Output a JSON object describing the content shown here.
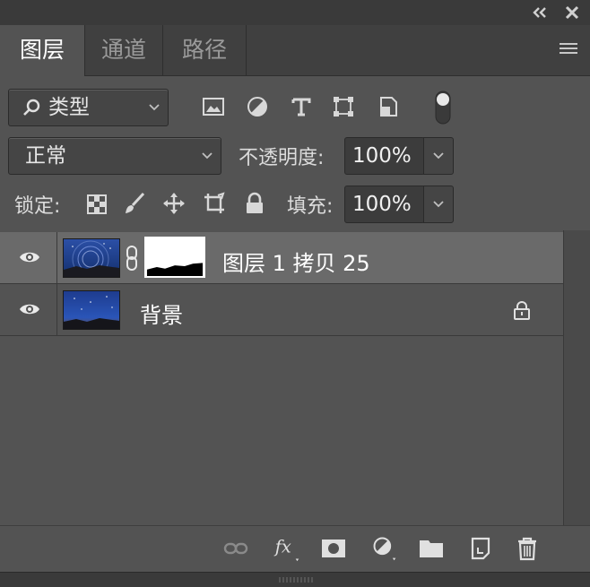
{
  "titlebar": {
    "collapse_icon": "double-chevron-left-icon",
    "close_icon": "close-icon"
  },
  "tabs": [
    {
      "label": "图层",
      "active": true
    },
    {
      "label": "通道",
      "active": false
    },
    {
      "label": "路径",
      "active": false
    }
  ],
  "filter": {
    "type_label": "类型"
  },
  "blend": {
    "mode": "正常",
    "opacity_label": "不透明度:",
    "opacity_value": "100%"
  },
  "lock": {
    "label": "锁定:",
    "fill_label": "填充:",
    "fill_value": "100%"
  },
  "layers": [
    {
      "name": "图层 1 拷贝 25",
      "visible": true,
      "selected": true,
      "has_mask": true
    },
    {
      "name": "背景",
      "visible": true,
      "selected": false,
      "locked": true
    }
  ],
  "colors": {
    "panel_bg": "#535353",
    "selected_row": "#6a6a6a",
    "text": "#ffffff"
  }
}
